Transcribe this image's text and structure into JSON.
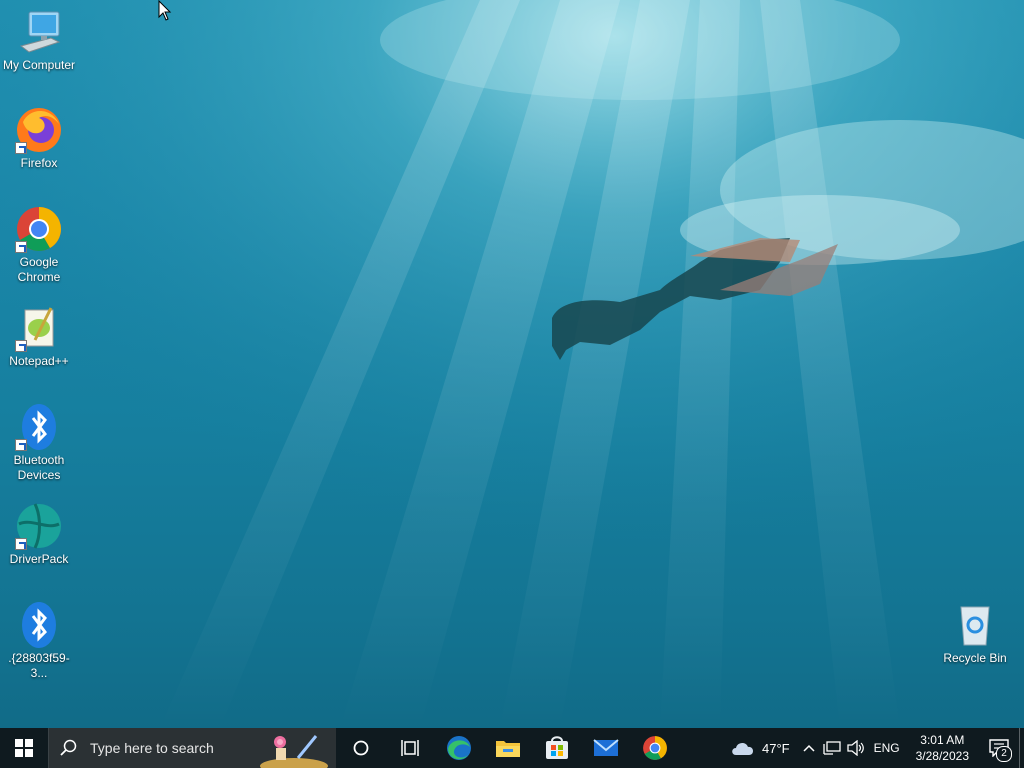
{
  "desktop": {
    "icons": [
      {
        "label": "My Computer",
        "icon": "computer-icon"
      },
      {
        "label": "Firefox",
        "icon": "firefox-icon"
      },
      {
        "label": "Google Chrome",
        "icon": "chrome-icon"
      },
      {
        "label": "Notepad++",
        "icon": "notepadpp-icon"
      },
      {
        "label": "Bluetooth Devices",
        "icon": "bluetooth-icon"
      },
      {
        "label": "DriverPack",
        "icon": "driverpack-icon"
      },
      {
        "label": ".{28803f59-3...",
        "icon": "bluetooth-icon"
      },
      {
        "label": "Recycle Bin",
        "icon": "recycle-bin-icon"
      }
    ]
  },
  "taskbar": {
    "search_placeholder": "Type here to search",
    "pinned": [
      "cortana-icon",
      "task-view-icon",
      "edge-icon",
      "file-explorer-icon",
      "store-icon",
      "mail-icon",
      "chrome-icon"
    ],
    "weather_temp": "47°F",
    "language": "ENG",
    "time": "3:01 AM",
    "date": "3/28/2023",
    "notification_count": "2"
  },
  "colors": {
    "taskbar_bg": "#0f1a1f",
    "search_bg": "#2b3134",
    "wallpaper": "#1a86a8"
  }
}
